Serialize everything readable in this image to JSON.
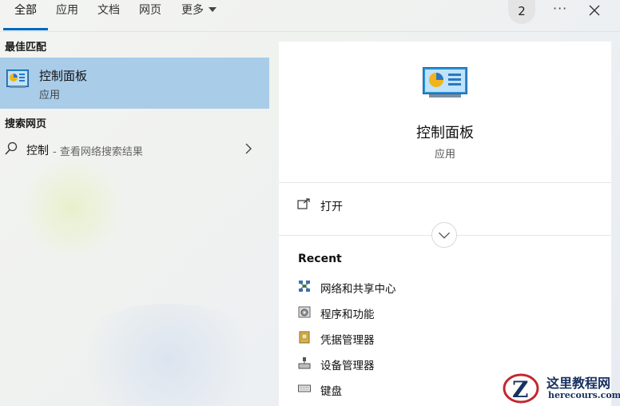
{
  "tabs": [
    {
      "label": "全部",
      "active": true
    },
    {
      "label": "应用",
      "active": false
    },
    {
      "label": "文档",
      "active": false
    },
    {
      "label": "网页",
      "active": false
    },
    {
      "label": "更多",
      "active": false
    }
  ],
  "top_right": {
    "badge_count": "2",
    "more_icon": "ellipsis-icon",
    "close_icon": "close-icon"
  },
  "best_match": {
    "heading": "最佳匹配",
    "title": "控制面板",
    "subtitle": "应用",
    "icon": "control-panel-icon"
  },
  "web_search": {
    "heading": "搜索网页",
    "query": "控制",
    "hint": " - 查看网络搜索结果"
  },
  "detail": {
    "title": "控制面板",
    "type": "应用",
    "open_label": "打开",
    "recent_heading": "Recent",
    "recent_items": [
      {
        "label": "网络和共享中心",
        "icon": "network-icon"
      },
      {
        "label": "程序和功能",
        "icon": "programs-icon"
      },
      {
        "label": "凭据管理器",
        "icon": "credential-icon"
      },
      {
        "label": "设备管理器",
        "icon": "device-manager-icon"
      },
      {
        "label": "键盘",
        "icon": "keyboard-icon"
      }
    ]
  },
  "watermark": {
    "title": "这里教程网",
    "url": "herecours.com"
  },
  "colors": {
    "selection": "#a9cce9",
    "accent": "#0067c0",
    "card": "#ffffff"
  }
}
